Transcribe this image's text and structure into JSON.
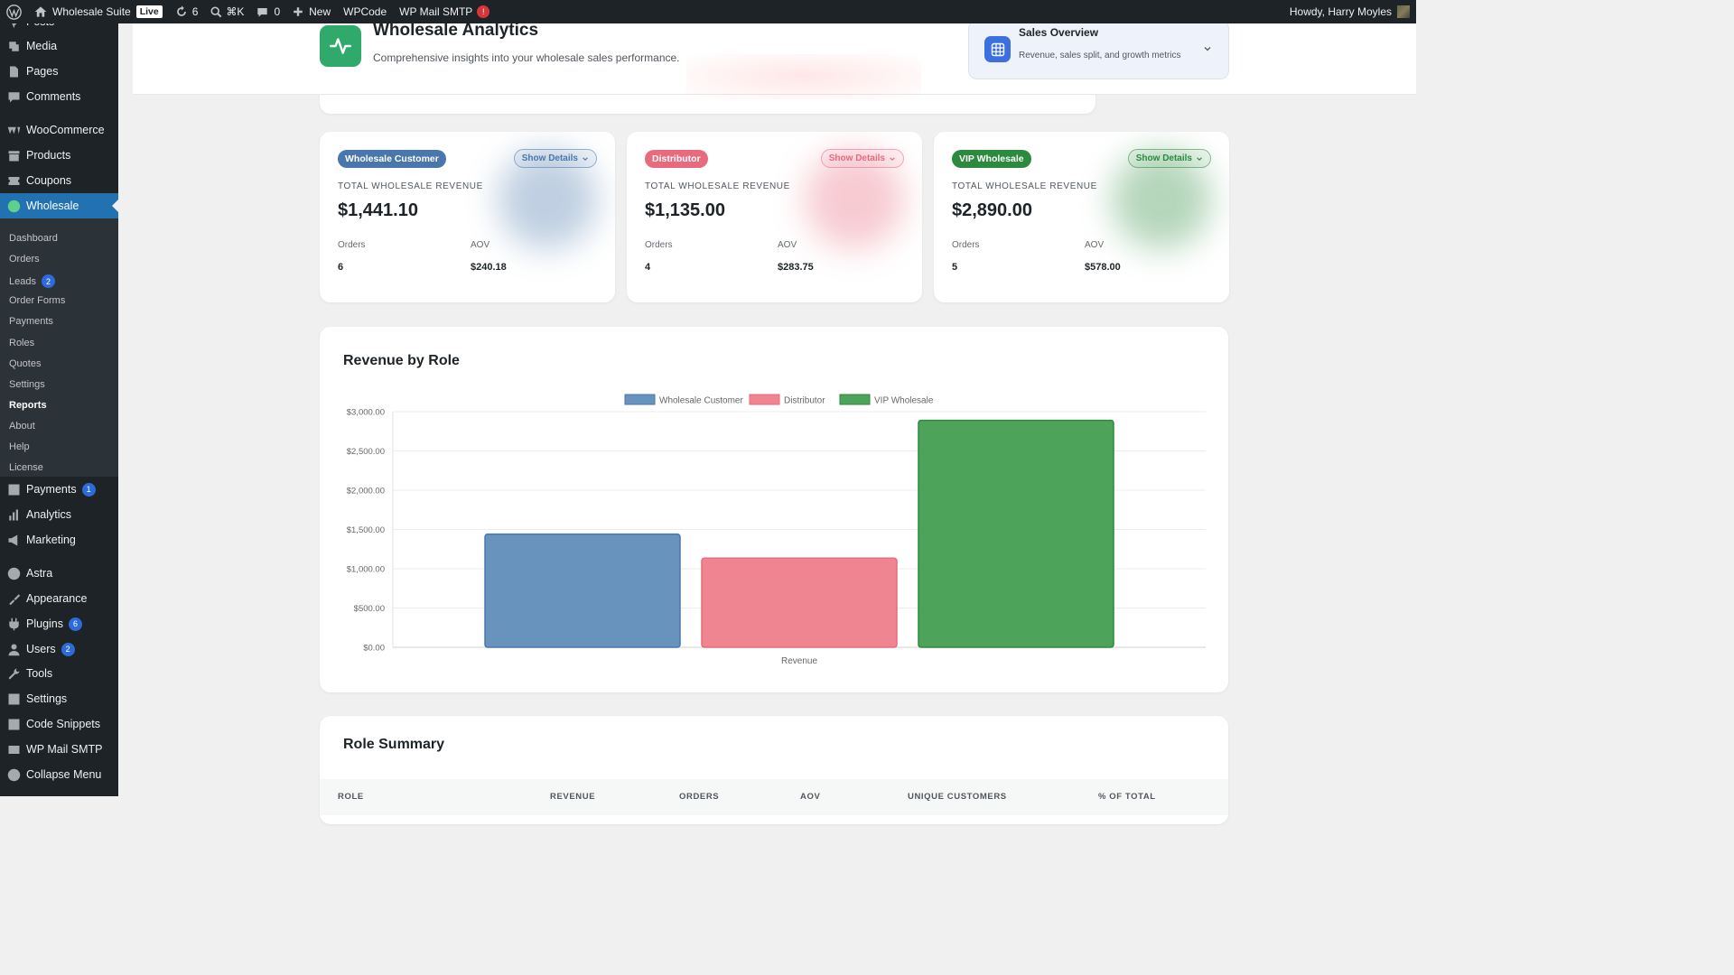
{
  "adminbar": {
    "site_name": "Wholesale Suite",
    "live_label": "Live",
    "updates_count": "6",
    "search_shortcut": "⌘K",
    "comments_count": "0",
    "new_label": "New",
    "wpcode_label": "WPCode",
    "smtp_label": "WP Mail SMTP",
    "smtp_alert": "!",
    "greeting": "Howdy, Harry Moyles"
  },
  "sidebar": {
    "items": [
      {
        "label": "Posts",
        "icon": "pin-icon"
      },
      {
        "label": "Media",
        "icon": "media-icon"
      },
      {
        "label": "Pages",
        "icon": "pages-icon"
      },
      {
        "label": "Comments",
        "icon": "comment-icon"
      },
      {
        "label": "WooCommerce",
        "icon": "woocommerce-icon"
      },
      {
        "label": "Products",
        "icon": "archive-icon"
      },
      {
        "label": "Coupons",
        "icon": "ticket-icon"
      },
      {
        "label": "Wholesale",
        "icon": "wholesale-icon"
      },
      {
        "label": "Payments",
        "icon": "dollar-icon",
        "badge": "1"
      },
      {
        "label": "Analytics",
        "icon": "bar-chart-icon"
      },
      {
        "label": "Marketing",
        "icon": "megaphone-icon"
      },
      {
        "label": "Astra",
        "icon": "astra-icon"
      },
      {
        "label": "Appearance",
        "icon": "brush-icon"
      },
      {
        "label": "Plugins",
        "icon": "plugin-icon",
        "badge": "6"
      },
      {
        "label": "Users",
        "icon": "user-icon",
        "badge": "2"
      },
      {
        "label": "Tools",
        "icon": "wrench-icon"
      },
      {
        "label": "Settings",
        "icon": "settings-icon"
      },
      {
        "label": "Code Snippets",
        "icon": "code-icon"
      },
      {
        "label": "WP Mail SMTP",
        "icon": "mail-icon"
      },
      {
        "label": "Collapse Menu",
        "icon": "collapse-icon"
      }
    ],
    "submenu": [
      {
        "label": "Dashboard"
      },
      {
        "label": "Orders"
      },
      {
        "label": "Leads",
        "badge": "2"
      },
      {
        "label": "Order Forms"
      },
      {
        "label": "Payments"
      },
      {
        "label": "Roles"
      },
      {
        "label": "Quotes"
      },
      {
        "label": "Settings"
      },
      {
        "label": "Reports"
      },
      {
        "label": "About"
      },
      {
        "label": "Help"
      },
      {
        "label": "License"
      }
    ]
  },
  "header": {
    "title": "Wholesale Analytics",
    "subtitle": "Comprehensive insights into your wholesale sales performance.",
    "report_selector": {
      "title": "Sales Overview",
      "subtitle": "Revenue, sales split, and growth metrics"
    }
  },
  "role_cards": [
    {
      "role": "Wholesale Customer",
      "color": "#4a77ab",
      "details_label": "Show Details",
      "revenue_label": "TOTAL WHOLESALE REVENUE",
      "revenue": "$1,441.10",
      "orders_label": "Orders",
      "orders": "6",
      "aov_label": "AOV",
      "aov": "$240.18"
    },
    {
      "role": "Distributor",
      "color": "#e86a7d",
      "details_label": "Show Details",
      "revenue_label": "TOTAL WHOLESALE REVENUE",
      "revenue": "$1,135.00",
      "orders_label": "Orders",
      "orders": "4",
      "aov_label": "AOV",
      "aov": "$283.75"
    },
    {
      "role": "VIP Wholesale",
      "color": "#2c8a3e",
      "details_label": "Show Details",
      "revenue_label": "TOTAL WHOLESALE REVENUE",
      "revenue": "$2,890.00",
      "orders_label": "Orders",
      "orders": "5",
      "aov_label": "AOV",
      "aov": "$578.00"
    }
  ],
  "revenue_section": {
    "title": "Revenue by Role"
  },
  "chart_data": {
    "type": "bar",
    "categories": [
      "Revenue"
    ],
    "xlabel": "Revenue",
    "ylim": [
      0,
      3000
    ],
    "yticks": [
      "$0.00",
      "$500.00",
      "$1,000.00",
      "$1,500.00",
      "$2,000.00",
      "$2,500.00",
      "$3,000.00"
    ],
    "legend_position": "top",
    "series": [
      {
        "name": "Wholesale Customer",
        "values": [
          1441.1
        ],
        "color": "#6793bd",
        "border": "#4a77ab"
      },
      {
        "name": "Distributor",
        "values": [
          1135.0
        ],
        "color": "#ef8590",
        "border": "#e86a7d"
      },
      {
        "name": "VIP Wholesale",
        "values": [
          2890.0
        ],
        "color": "#4ea35a",
        "border": "#2c8a3e"
      }
    ]
  },
  "summary": {
    "title": "Role Summary",
    "columns": [
      "ROLE",
      "REVENUE",
      "ORDERS",
      "AOV",
      "UNIQUE CUSTOMERS",
      "% OF TOTAL"
    ]
  }
}
